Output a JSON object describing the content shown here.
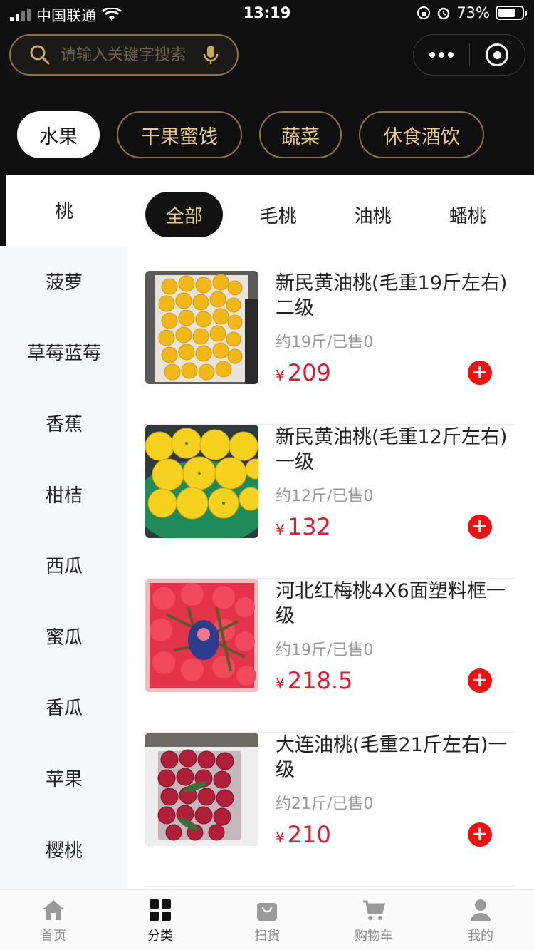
{
  "status_bar": {
    "carrier": "中国联通",
    "time": "13:19",
    "battery": "73%"
  },
  "search": {
    "placeholder": "请输入关键字搜索"
  },
  "categories": [
    {
      "label": "水果",
      "active": true
    },
    {
      "label": "干果蜜饯",
      "active": false
    },
    {
      "label": "蔬菜",
      "active": false
    },
    {
      "label": "休食酒饮",
      "active": false
    }
  ],
  "sidebar": {
    "items": [
      {
        "label": "桃",
        "active": true
      },
      {
        "label": "菠萝"
      },
      {
        "label": "草莓蓝莓"
      },
      {
        "label": "香蕉"
      },
      {
        "label": "柑桔"
      },
      {
        "label": "西瓜"
      },
      {
        "label": "蜜瓜"
      },
      {
        "label": "香瓜"
      },
      {
        "label": "苹果"
      },
      {
        "label": "樱桃"
      }
    ]
  },
  "subtabs": [
    {
      "label": "全部",
      "active": true
    },
    {
      "label": "毛桃"
    },
    {
      "label": "油桃"
    },
    {
      "label": "蟠桃"
    }
  ],
  "products": [
    {
      "name": "新民黄油桃(毛重19斤左右)二级",
      "meta": "约19斤/已售0",
      "currency": "¥",
      "price": "209",
      "image": "yellow-peaches-crate"
    },
    {
      "name": "新民黄油桃(毛重12斤左右)一级",
      "meta": "约12斤/已售0",
      "currency": "¥",
      "price": "132",
      "image": "yellow-peaches-basin"
    },
    {
      "name": "河北红梅桃4X6面塑料框一级",
      "meta": "约19斤/已售0",
      "currency": "¥",
      "price": "218.5",
      "image": "red-peaches-box"
    },
    {
      "name": "大连油桃(毛重21斤左右)一级",
      "meta": "约21斤/已售0",
      "currency": "¥",
      "price": "210",
      "image": "red-nectarines-box"
    }
  ],
  "tabbar": [
    {
      "label": "首页",
      "icon": "home-icon"
    },
    {
      "label": "分类",
      "icon": "grid-icon",
      "active": true
    },
    {
      "label": "扫货",
      "icon": "bag-icon"
    },
    {
      "label": "购物车",
      "icon": "cart-icon"
    },
    {
      "label": "我的",
      "icon": "user-icon"
    }
  ],
  "colors": {
    "accent_gold": "#e8cc8c",
    "price_red": "#e8162e",
    "header_bg": "#0f0f0f"
  }
}
